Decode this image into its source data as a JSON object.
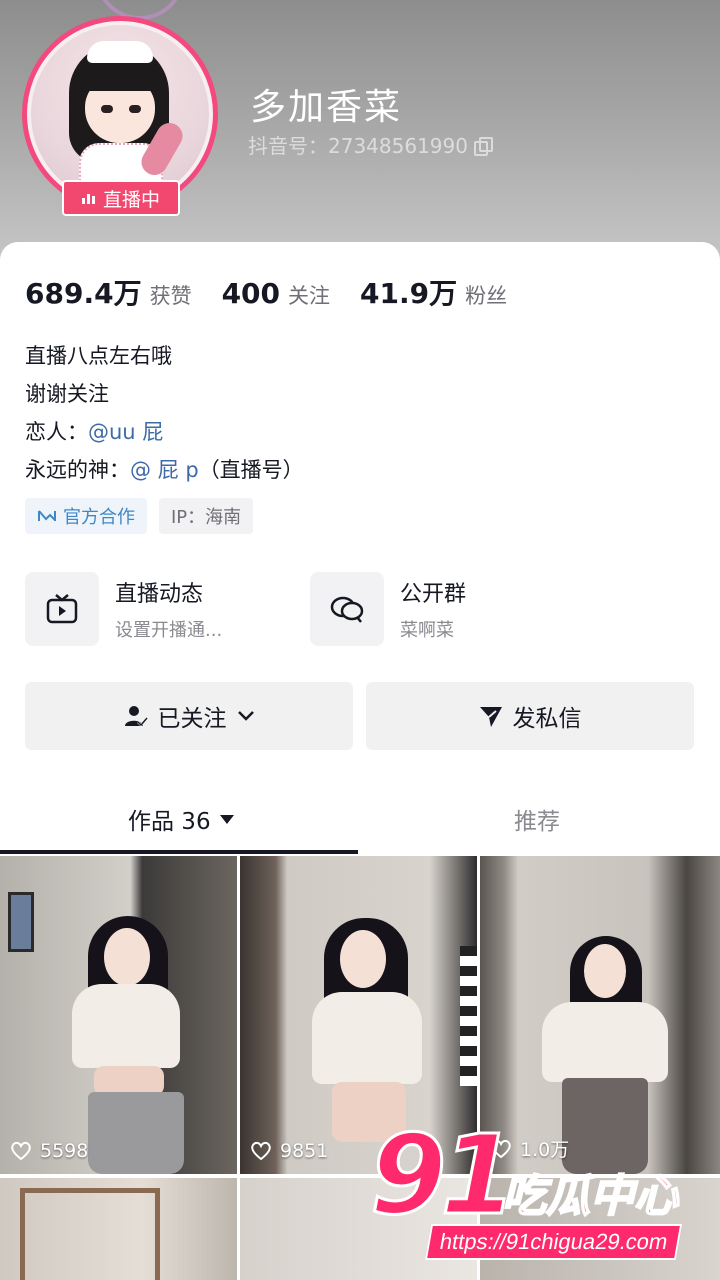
{
  "profile": {
    "nickname": "多加香菜",
    "douyin_id": "抖音号：27348561990",
    "live_badge": "直播中"
  },
  "stats": [
    {
      "value": "689.4万",
      "label": "获赞"
    },
    {
      "value": "400",
      "label": "关注"
    },
    {
      "value": "41.9万",
      "label": "粉丝"
    }
  ],
  "bio": {
    "line1": "直播八点左右哦",
    "line2": "谢谢关注",
    "line3_prefix": "恋人：",
    "line3_mention": "@uu 屁",
    "line4_prefix": "永远的神：",
    "line4_mention": "@ 屁 p",
    "line4_suffix": "（直播号）"
  },
  "tags": {
    "official": "官方合作",
    "ip": "IP：海南"
  },
  "features": {
    "live": {
      "title": "直播动态",
      "sub": "设置开播通..."
    },
    "group": {
      "title": "公开群",
      "sub": "菜啊菜"
    }
  },
  "buttons": {
    "follow": "已关注",
    "message": "发私信"
  },
  "tabs": {
    "works": "作品 36",
    "recommend": "推荐"
  },
  "videos": [
    {
      "likes": "5598"
    },
    {
      "likes": "9851"
    },
    {
      "likes": "1.0万"
    }
  ],
  "watermark": {
    "brand_number": "91",
    "brand_text": "吃瓜中心",
    "url": "https://91chigua29.com"
  },
  "colors": {
    "accent_pink": "#f2476f",
    "mention_blue": "#3e6ba8",
    "watermark_pink": "#ff2a6d"
  }
}
